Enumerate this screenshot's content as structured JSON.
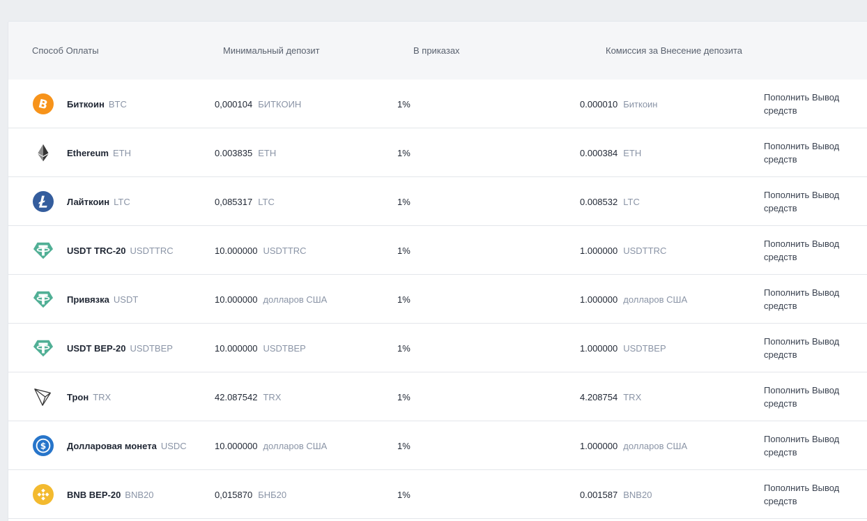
{
  "table": {
    "headers": {
      "method": "Способ Оплаты",
      "min_deposit": "Минимальный депозит",
      "in_orders": "В приказах",
      "fee": "Комиссия за Внесение депозита"
    },
    "rows": [
      {
        "icon": "bitcoin-icon",
        "icon_color": "#f7931a",
        "name": "Биткоин",
        "code": "BTC",
        "min_value": "0,000104",
        "min_unit": "БИТКОИН",
        "orders": "1%",
        "fee_value": "0.000010",
        "fee_unit": "Биткоин",
        "deposit_label": "Пополнить",
        "withdraw_label": "Вывод средств"
      },
      {
        "icon": "ethereum-icon",
        "icon_color": "#343434",
        "name": "Ethereum",
        "code": "ETH",
        "min_value": "0.003835",
        "min_unit": "ETH",
        "orders": "1%",
        "fee_value": "0.000384",
        "fee_unit": "ETH",
        "deposit_label": "Пополнить",
        "withdraw_label": "Вывод средств"
      },
      {
        "icon": "litecoin-icon",
        "icon_color": "#345d9d",
        "name": "Лайткоин",
        "code": "LTC",
        "min_value": "0,085317",
        "min_unit": "LTC",
        "orders": "1%",
        "fee_value": "0.008532",
        "fee_unit": "LTC",
        "deposit_label": "Пополнить",
        "withdraw_label": "Вывод средств"
      },
      {
        "icon": "tether-icon",
        "icon_color": "#50af95",
        "name": "USDT TRC-20",
        "code": "USDTTRC",
        "min_value": "10.000000",
        "min_unit": "USDTTRC",
        "orders": "1%",
        "fee_value": "1.000000",
        "fee_unit": "USDTTRC",
        "deposit_label": "Пополнить",
        "withdraw_label": "Вывод средств"
      },
      {
        "icon": "tether-icon",
        "icon_color": "#50af95",
        "name": "Привязка",
        "code": "USDT",
        "min_value": "10.000000",
        "min_unit": "долларов США",
        "orders": "1%",
        "fee_value": "1.000000",
        "fee_unit": "долларов США",
        "deposit_label": "Пополнить",
        "withdraw_label": "Вывод средств"
      },
      {
        "icon": "tether-icon",
        "icon_color": "#50af95",
        "name": "USDT BEP-20",
        "code": "USDTBEP",
        "min_value": "10.000000",
        "min_unit": "USDTBEP",
        "orders": "1%",
        "fee_value": "1.000000",
        "fee_unit": "USDTBEP",
        "deposit_label": "Пополнить",
        "withdraw_label": "Вывод средств"
      },
      {
        "icon": "tron-icon",
        "icon_color": "#333333",
        "name": "Трон",
        "code": "TRX",
        "min_value": "42.087542",
        "min_unit": "TRX",
        "orders": "1%",
        "fee_value": "4.208754",
        "fee_unit": "TRX",
        "deposit_label": "Пополнить",
        "withdraw_label": "Вывод средств"
      },
      {
        "icon": "usdc-icon",
        "icon_color": "#2775ca",
        "name": "Долларовая монета",
        "code": "USDC",
        "min_value": "10.000000",
        "min_unit": "долларов США",
        "orders": "1%",
        "fee_value": "1.000000",
        "fee_unit": "долларов США",
        "deposit_label": "Пополнить",
        "withdraw_label": "Вывод средств"
      },
      {
        "icon": "bnb-icon",
        "icon_color": "#f3ba2f",
        "name": "BNB BEP-20",
        "code": "BNB20",
        "min_value": "0,015870",
        "min_unit": "БНБ20",
        "orders": "1%",
        "fee_value": "0.001587",
        "fee_unit": "BNB20",
        "deposit_label": "Пополнить",
        "withdraw_label": "Вывод средств"
      }
    ]
  }
}
